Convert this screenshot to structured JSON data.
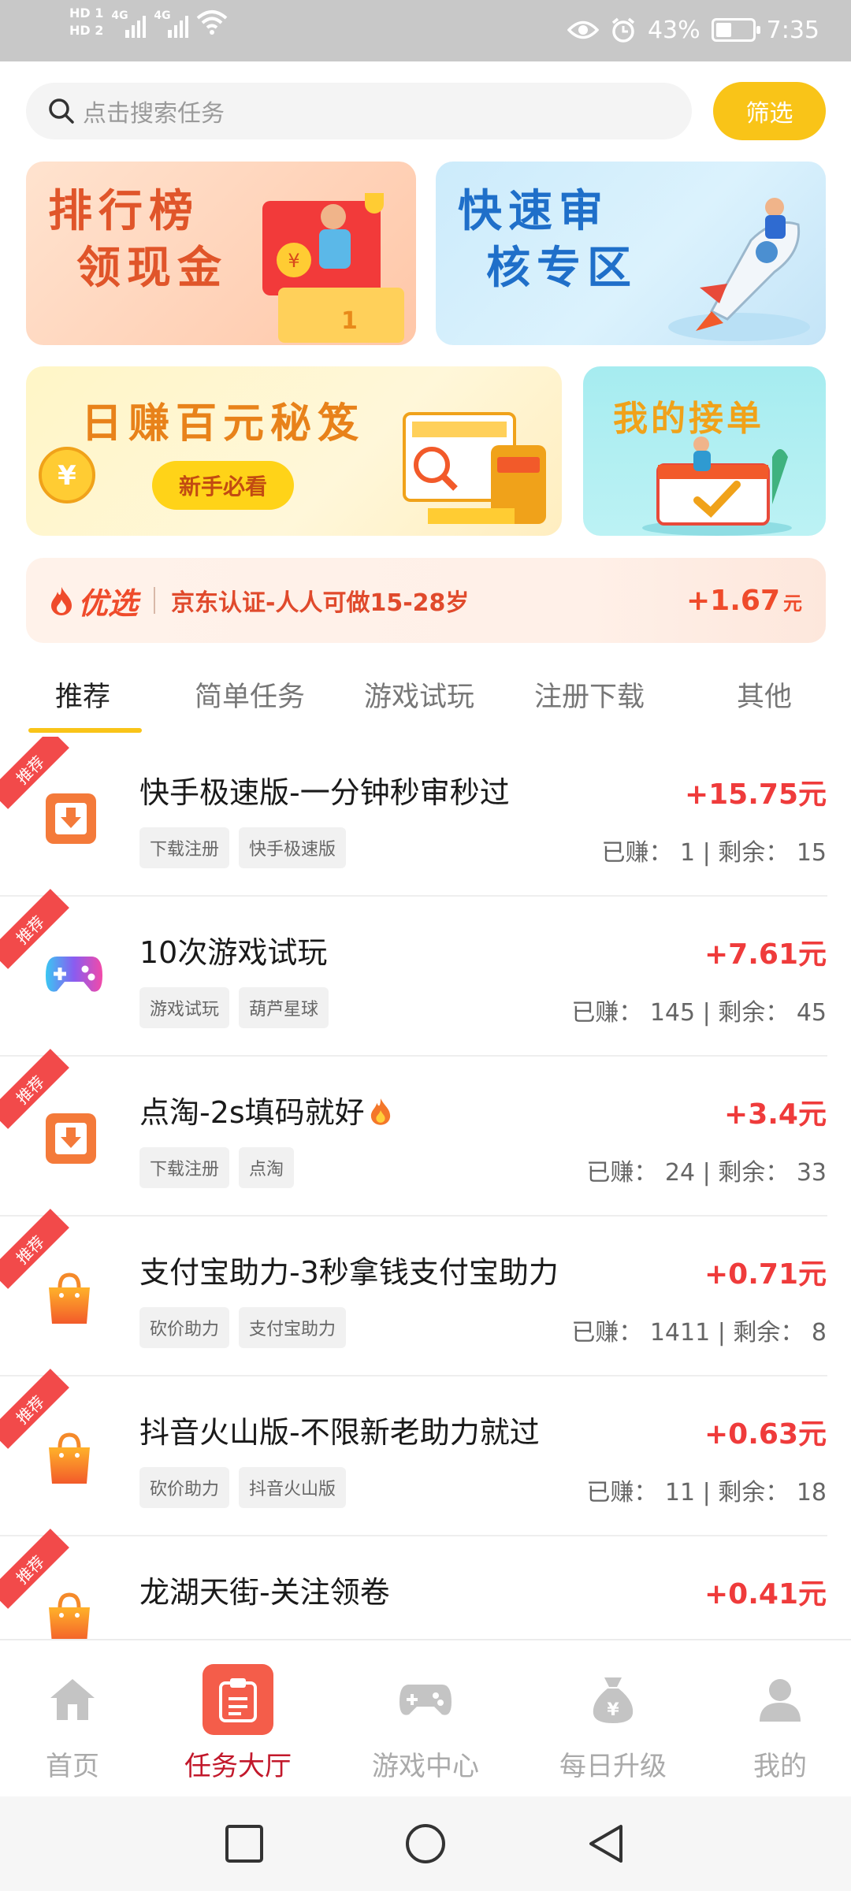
{
  "status_bar": {
    "hd1": "HD 1",
    "hd2": "HD 2",
    "net1": "4G",
    "net2": "4G",
    "battery_text": "43%",
    "battery_level": 0.43,
    "time": "7:35",
    "icons": [
      "eye-icon",
      "alarm-icon",
      "battery-icon",
      "wifi-icon"
    ]
  },
  "search": {
    "placeholder": "点击搜索任务",
    "filter_label": "筛选"
  },
  "banners": {
    "leaderboard": {
      "line1": "排行榜",
      "line2": "领现金"
    },
    "fast_review": {
      "line1": "快速审",
      "line2": "核专区"
    },
    "daily_tips": {
      "title": "日赚百元秘笈",
      "pill": "新手必看"
    },
    "my_orders": {
      "title": "我的接单"
    }
  },
  "featured": {
    "label": "优选",
    "text": "京东认证-人人可做15-28岁",
    "reward": "+1.67",
    "unit": "元"
  },
  "tabs": [
    "推荐",
    "简单任务",
    "游戏试玩",
    "注册下载",
    "其他"
  ],
  "ribbon_label": "推荐",
  "stats_labels": {
    "earned": "已赚：",
    "remaining": "剩余："
  },
  "tasks": [
    {
      "title": "快手极速版-一分钟秒审秒过",
      "reward": "+15.75元",
      "tags": [
        "下载注册",
        "快手极速版"
      ],
      "earned": "1",
      "remaining": "15",
      "icon": "download-icon"
    },
    {
      "title": "10次游戏试玩",
      "reward": "+7.61元",
      "tags": [
        "游戏试玩",
        "葫芦星球"
      ],
      "earned": "145",
      "remaining": "45",
      "icon": "gamepad-icon"
    },
    {
      "title": "点淘-2s填码就好",
      "reward": "+3.4元",
      "tags": [
        "下载注册",
        "点淘"
      ],
      "earned": "24",
      "remaining": "33",
      "icon": "download-icon",
      "hot": true
    },
    {
      "title": "支付宝助力-3秒拿钱支付宝助力",
      "reward": "+0.71元",
      "tags": [
        "砍价助力",
        "支付宝助力"
      ],
      "earned": "1411",
      "remaining": "8",
      "icon": "shopping-bag-icon"
    },
    {
      "title": "抖音火山版-不限新老助力就过",
      "reward": "+0.63元",
      "tags": [
        "砍价助力",
        "抖音火山版"
      ],
      "earned": "11",
      "remaining": "18",
      "icon": "shopping-bag-icon"
    },
    {
      "title": "龙湖天街-关注领卷",
      "reward": "+0.41元",
      "tags": [],
      "earned": "",
      "remaining": "",
      "icon": "shopping-bag-icon"
    }
  ],
  "bottom_nav": [
    {
      "label": "首页",
      "icon": "home-icon",
      "active": false
    },
    {
      "label": "任务大厅",
      "icon": "clipboard-icon",
      "active": true
    },
    {
      "label": "游戏中心",
      "icon": "gamepad-icon",
      "active": false
    },
    {
      "label": "每日升级",
      "icon": "money-bag-icon",
      "active": false
    },
    {
      "label": "我的",
      "icon": "user-icon",
      "active": false
    }
  ],
  "colors": {
    "accent_yellow": "#f9c418",
    "reward_red": "#ef3b3b",
    "active_nav": "#c2182b"
  }
}
